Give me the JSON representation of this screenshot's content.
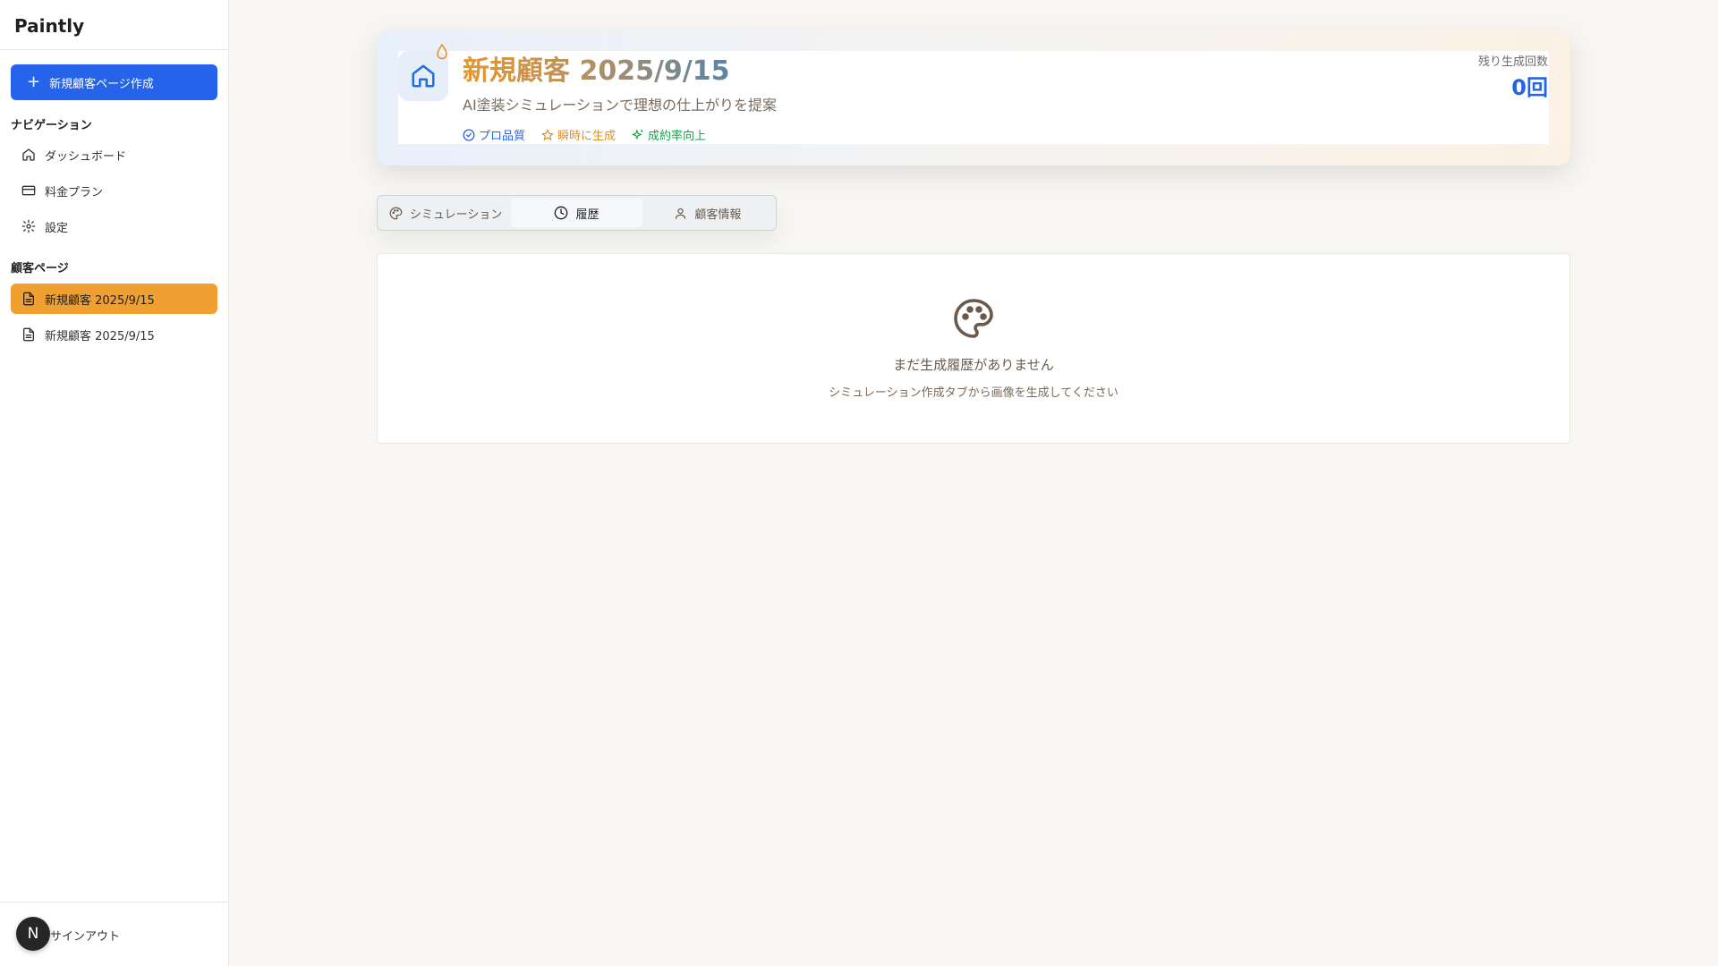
{
  "app": {
    "name": "Paintly"
  },
  "sidebar": {
    "new_button": "新規顧客ページ作成",
    "nav_heading": "ナビゲーション",
    "nav_items": [
      {
        "label": "ダッシュボード",
        "icon": "home-icon"
      },
      {
        "label": "料金プラン",
        "icon": "credit-card-icon"
      },
      {
        "label": "設定",
        "icon": "gear-icon"
      }
    ],
    "customers_heading": "顧客ページ",
    "customer_items": [
      {
        "label": "新規顧客 2025/9/15",
        "active": true
      },
      {
        "label": "新規顧客 2025/9/15",
        "active": false
      }
    ],
    "footer": {
      "avatar_initial": "N",
      "signout": "サインアウト"
    }
  },
  "header": {
    "title": "新規顧客 2025/9/15",
    "subtitle": "AI塗装シミュレーションで理想の仕上がりを提案",
    "tags": [
      {
        "label": "プロ品質",
        "icon": "check-circle-icon",
        "color": "#2563eb"
      },
      {
        "label": "瞬時に生成",
        "icon": "star-icon",
        "color": "#e0902a"
      },
      {
        "label": "成約率向上",
        "icon": "sparkle-icon",
        "color": "#16a34a"
      }
    ],
    "remaining_label": "残り生成回数",
    "remaining_value": "0回"
  },
  "tabs": [
    {
      "label": "シミュレーション",
      "icon": "palette-icon",
      "active": false
    },
    {
      "label": "履歴",
      "icon": "clock-icon",
      "active": true
    },
    {
      "label": "顧客情報",
      "icon": "user-icon",
      "active": false
    }
  ],
  "history": {
    "empty_title": "まだ生成履歴がありません",
    "empty_subtitle": "シミュレーション作成タブから画像を生成してください"
  },
  "colors": {
    "primary": "#2563eb",
    "accent": "#f0a030",
    "background": "#f8f6f3"
  }
}
